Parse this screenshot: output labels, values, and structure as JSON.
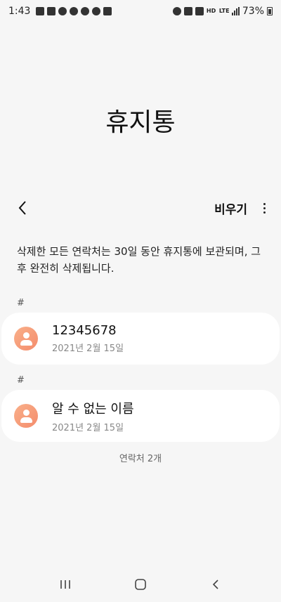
{
  "status_bar": {
    "time": "1:43",
    "battery": "73%",
    "hd_label": "HD",
    "lte_label": "LTE"
  },
  "page_title": "휴지통",
  "toolbar": {
    "back_icon": "chevron-left-icon",
    "empty_label": "비우기",
    "more_icon": "more-vertical-icon"
  },
  "notice": "삭제한 모든 연락처는 30일 동안 휴지통에 보관되며, 그 후 완전히 삭제됩니다.",
  "groups": [
    {
      "header": "#",
      "contact": {
        "name": "12345678",
        "date": "2021년 2월 15일",
        "avatar_icon": "person-icon"
      }
    },
    {
      "header": "#",
      "contact": {
        "name": "알 수 없는 이름",
        "date": "2021년 2월 15일",
        "avatar_icon": "person-icon"
      }
    }
  ],
  "count_label": "연락처 2개",
  "nav": {
    "recents_icon": "recents-icon",
    "home_icon": "home-icon",
    "back_icon": "back-icon"
  },
  "colors": {
    "background": "#f6f6f6",
    "card": "#ffffff",
    "avatar": "#f59a78"
  }
}
